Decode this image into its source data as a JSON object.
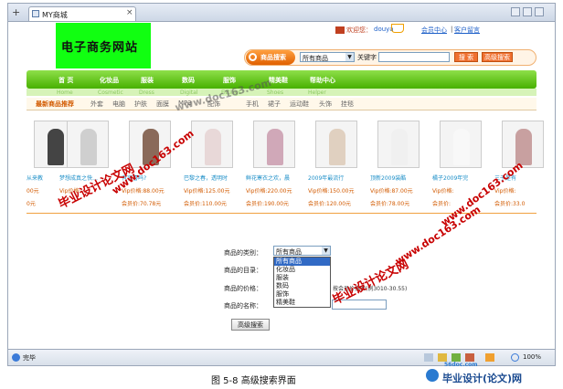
{
  "tab": {
    "label": "MY商城"
  },
  "header": {
    "site_title": "电子商务网站",
    "welcome": "欢迎您：",
    "username": "douya",
    "user_center": "会员中心",
    "service": "客户留言",
    "search_label": "商品搜索",
    "search_select": "所有商品",
    "keyword_label": "关键字",
    "search_btn": "搜 索",
    "advanced_btn": "高级搜索"
  },
  "nav": {
    "items": [
      {
        "cn": "首 页",
        "en": "Home"
      },
      {
        "cn": "化妆品",
        "en": "Cosmetic"
      },
      {
        "cn": "服装",
        "en": "Dress"
      },
      {
        "cn": "数码",
        "en": "Digital"
      },
      {
        "cn": "服饰",
        "en": "Fittings"
      },
      {
        "cn": "精美鞋",
        "en": "Shoes"
      },
      {
        "cn": "帮助中心",
        "en": "Helper"
      }
    ],
    "promo": "最新商品推荐",
    "subcats": [
      "外套",
      "电脑",
      "护肤",
      "面膜",
      "MP3",
      "配饰",
      "",
      "手机",
      "裙子",
      "运动鞋",
      "头饰",
      "挂毯"
    ]
  },
  "products": [
    {
      "name": "从来教",
      "vip": "00元",
      "member": "0元"
    },
    {
      "name": "梦想成真之快…",
      "vip": "Vip价格:",
      "member": ""
    },
    {
      "name": "有容喜吗?",
      "vip": "Vip价格:88.00元",
      "member": "会员价:70.78元"
    },
    {
      "name": "巴黎之春，透明时",
      "vip": "Vip价格:125.00元",
      "member": "会员价:110.00元"
    },
    {
      "name": "鲜花寒衣之欢，晨",
      "vip": "Vip价格:220.00元",
      "member": "会员价:190.00元"
    },
    {
      "name": "2009年最流行",
      "vip": "Vip价格:150.00元",
      "member": "会员价:120.00元"
    },
    {
      "name": "顶新2009装酷",
      "vip": "Vip价格:87.00元",
      "member": "会员价:78.00元"
    },
    {
      "name": "橘子2009年完",
      "vip": "Vip价格:",
      "member": "会员价:"
    },
    {
      "name": "三子是有",
      "vip": "Vip价格:",
      "member": "会员价:33.0"
    }
  ],
  "form": {
    "category_label": "商品的类别：",
    "category_value": "所有商品",
    "catalog_label": "商品的目录：",
    "price_label": "商品的价格：",
    "price_hint": "按会员价搜索(例3010-30.55)",
    "name_label": "商品的名称：",
    "submit": "高级搜索",
    "options": [
      "所有商品",
      "化妆品",
      "服装",
      "数码",
      "服饰",
      "精美鞋"
    ]
  },
  "watermark": {
    "text1": "毕业设计论文网",
    "text2": "www.doc163.com"
  },
  "status": {
    "done": "完毕",
    "zoom": "100%"
  },
  "caption": "图 5-8 高级搜索界面",
  "footer_logo": {
    "site": "56doc.com",
    "text": "毕业设计(论文)网"
  },
  "colors": {
    "accent_green": "#47b000",
    "orange": "#f08010",
    "link_blue": "#1d5fc8",
    "price_red": "#d25a00"
  }
}
